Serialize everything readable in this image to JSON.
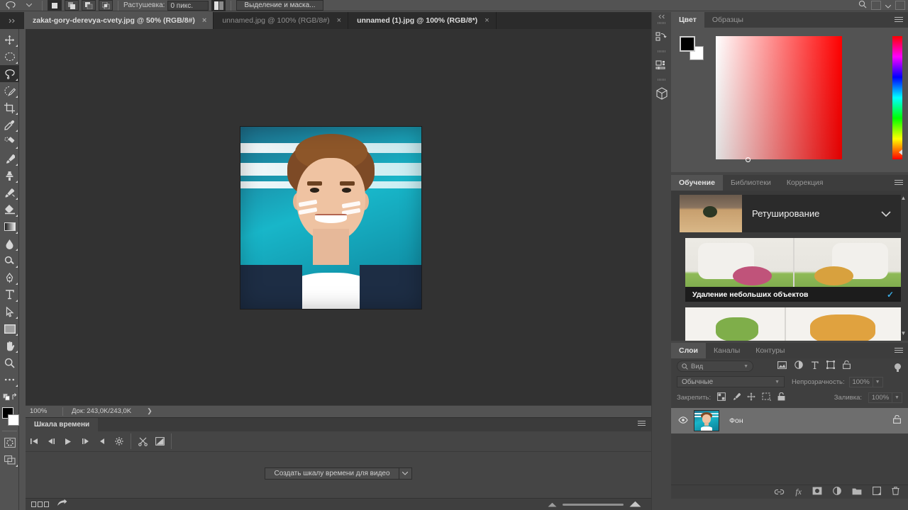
{
  "app": {
    "name": "Adobe Photoshop"
  },
  "options_bar": {
    "tool_icon": "lasso-icon",
    "preset_chevron": "chevron-down-icon",
    "selection_modes": [
      {
        "name": "new-selection",
        "active": true
      },
      {
        "name": "add-to-selection",
        "active": false
      },
      {
        "name": "subtract-from-selection",
        "active": false
      },
      {
        "name": "intersect-selection",
        "active": false
      }
    ],
    "feather_label": "Растушевка:",
    "feather_value": "0 пикс.",
    "antialias_icon": "anti-alias-icon",
    "select_and_mask_label": "Выделение и маска...",
    "right_icons": [
      "search-icon",
      "workspace-icon",
      "chevron-down-icon",
      "arrange-icon"
    ]
  },
  "tabs": {
    "grip_icon": "panel-grip-icon",
    "items": [
      {
        "title": "zakat-gory-derevya-cvety.jpg @ 50% (RGB/8#)",
        "active": true,
        "close": "×"
      },
      {
        "title": "unnamed.jpg @ 100% (RGB/8#)",
        "active": false,
        "close": "×"
      },
      {
        "title": "unnamed (1).jpg @ 100% (RGB/8*)",
        "active": false,
        "close": "×"
      }
    ]
  },
  "toolbar": {
    "tools": [
      {
        "name": "move-tool",
        "selected": false,
        "has_corner": true
      },
      {
        "name": "elliptical-marquee-tool",
        "selected": false,
        "has_corner": true
      },
      {
        "name": "lasso-tool",
        "selected": true,
        "has_corner": true
      },
      {
        "name": "quick-selection-tool",
        "selected": false,
        "has_corner": true
      },
      {
        "name": "crop-tool",
        "selected": false,
        "has_corner": true
      },
      {
        "name": "eyedropper-tool",
        "selected": false,
        "has_corner": true
      },
      {
        "name": "spot-healing-brush-tool",
        "selected": false,
        "has_corner": true
      },
      {
        "name": "brush-tool",
        "selected": false,
        "has_corner": true
      },
      {
        "name": "clone-stamp-tool",
        "selected": false,
        "has_corner": true
      },
      {
        "name": "history-brush-tool",
        "selected": false,
        "has_corner": true
      },
      {
        "name": "eraser-tool",
        "selected": false,
        "has_corner": true
      },
      {
        "name": "gradient-tool",
        "selected": false,
        "has_corner": true
      },
      {
        "name": "blur-tool",
        "selected": false,
        "has_corner": true
      },
      {
        "name": "dodge-tool",
        "selected": false,
        "has_corner": true
      },
      {
        "name": "pen-tool",
        "selected": false,
        "has_corner": true
      },
      {
        "name": "type-tool",
        "selected": false,
        "has_corner": true
      },
      {
        "name": "path-selection-tool",
        "selected": false,
        "has_corner": true
      },
      {
        "name": "rectangle-tool",
        "selected": false,
        "has_corner": true
      },
      {
        "name": "hand-tool",
        "selected": false,
        "has_corner": true
      },
      {
        "name": "zoom-tool",
        "selected": false,
        "has_corner": false
      },
      {
        "name": "edit-toolbar-tool",
        "selected": false,
        "has_corner": false
      }
    ],
    "quick_mask_icon": "quick-mask-icon",
    "screen_mode_icon": "screen-mode-icon",
    "foreground_color": "#000000",
    "background_color": "#ffffff"
  },
  "canvas": {
    "document_name": "unnamed (1).jpg",
    "background": "#323232"
  },
  "status_bar": {
    "zoom": "100%",
    "doc_label": "Док:",
    "doc_size": "243,0K/243,0K",
    "expand_icon": "chevron-right-icon"
  },
  "timeline": {
    "tab_label": "Шкала времени",
    "menu_icon": "panel-menu-icon",
    "controls": [
      {
        "name": "go-to-first-frame-button",
        "glyph": "⏮"
      },
      {
        "name": "previous-frame-button",
        "glyph": "◁|"
      },
      {
        "name": "play-button",
        "glyph": "▶"
      },
      {
        "name": "next-frame-button",
        "glyph": "|▷"
      },
      {
        "name": "audio-button",
        "glyph": "◀"
      },
      {
        "name": "settings-button",
        "glyph": "⚙"
      },
      {
        "name": "split-clip-button",
        "glyph": "✂"
      },
      {
        "name": "transition-button",
        "glyph": "◪"
      }
    ],
    "create_button_label": "Создать шкалу времени для видео",
    "create_dropdown_icon": "chevron-down-icon",
    "footer_icons": [
      "frame-view-icon",
      "render-video-icon",
      "zoom-out-icon",
      "zoom-in-icon"
    ]
  },
  "rail": {
    "collapse_icon": "collapse-panels-icon",
    "items": [
      {
        "name": "history-panel-icon"
      },
      {
        "name": "properties-panel-icon"
      },
      {
        "name": "3d-panel-icon"
      }
    ]
  },
  "color_panel": {
    "tabs": [
      {
        "label": "Цвет",
        "active": true
      },
      {
        "label": "Образцы",
        "active": false
      }
    ],
    "menu_icon": "panel-menu-icon",
    "foreground": "#000000",
    "background": "#ffffff",
    "spectrum_name": "color-ramp",
    "hue_slider_name": "hue-slider"
  },
  "learn_panel": {
    "tabs": [
      {
        "label": "Обучение",
        "active": true
      },
      {
        "label": "Библиотеки",
        "active": false
      },
      {
        "label": "Коррекция",
        "active": false
      }
    ],
    "menu_icon": "panel-menu-icon",
    "card_title": "Ретуширование",
    "card_chevron": "chevron-down-icon",
    "lesson_title": "Удаление небольших объектов",
    "lesson_check": "✓",
    "scroll_up_icon": "chevron-up-icon",
    "scroll_down_icon": "chevron-down-icon"
  },
  "layers_panel": {
    "tabs": [
      {
        "label": "Слои",
        "active": true
      },
      {
        "label": "Каналы",
        "active": false
      },
      {
        "label": "Контуры",
        "active": false
      }
    ],
    "menu_icon": "panel-menu-icon",
    "filter_placeholder": "Вид",
    "filter_icons": [
      "pixel-filter-icon",
      "adjustment-filter-icon",
      "type-filter-icon",
      "shape-filter-icon",
      "smart-object-filter-icon"
    ],
    "filter_toggle_name": "filter-enable-toggle",
    "blend_mode": "Обычные",
    "opacity_label": "Непрозрачность:",
    "opacity_value": "100%",
    "lock_label": "Закрепить:",
    "lock_icons": [
      "lock-transparency-icon",
      "lock-image-icon",
      "lock-position-icon",
      "lock-artboard-icon",
      "lock-all-icon"
    ],
    "fill_label": "Заливка:",
    "fill_value": "100%",
    "layers": [
      {
        "name": "Фон",
        "visible": true,
        "locked": true
      }
    ],
    "footer_icons": [
      "link-layers-icon",
      "add-style-fx-icon",
      "add-mask-icon",
      "adjustment-layer-icon",
      "new-group-icon",
      "new-layer-icon",
      "delete-layer-icon"
    ]
  }
}
